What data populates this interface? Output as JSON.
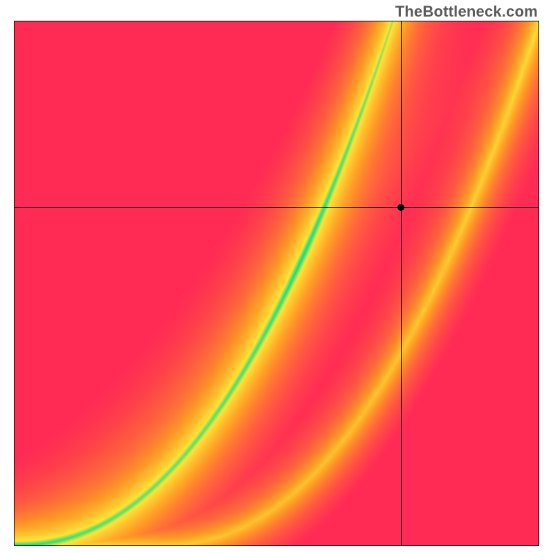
{
  "watermark": "TheBottleneck.com",
  "plot": {
    "crosshair": {
      "x_frac": 0.738,
      "y_frac": 0.355
    },
    "marker": {
      "x_frac": 0.738,
      "y_frac": 0.355
    },
    "ridge": {
      "x0": 0.0,
      "a": 2.05,
      "b": 2.2,
      "width0": 0.03,
      "width1": 0.11,
      "lobe_scale": 0.72
    },
    "colors": {
      "green": "#00e08a",
      "yellow": "#ffe536",
      "orange": "#ff9b26",
      "red": "#ff2b55"
    }
  },
  "chart_data": {
    "type": "heatmap",
    "title": "",
    "xlabel": "",
    "ylabel": "",
    "xlim": [
      0,
      1
    ],
    "ylim": [
      0,
      1
    ],
    "ridge_samples": [
      {
        "x": 0.0,
        "y": 0.0
      },
      {
        "x": 0.1,
        "y": 0.045
      },
      {
        "x": 0.2,
        "y": 0.125
      },
      {
        "x": 0.3,
        "y": 0.235
      },
      {
        "x": 0.4,
        "y": 0.37
      },
      {
        "x": 0.5,
        "y": 0.52
      },
      {
        "x": 0.6,
        "y": 0.68
      },
      {
        "x": 0.7,
        "y": 0.85
      },
      {
        "x": 0.76,
        "y": 0.96
      },
      {
        "x": 0.8,
        "y": 1.0
      }
    ],
    "secondary_lobe_offset": 0.28,
    "colorscale": [
      {
        "t": 0.0,
        "label": "green"
      },
      {
        "t": 0.18,
        "label": "yellow"
      },
      {
        "t": 0.55,
        "label": "orange"
      },
      {
        "t": 1.0,
        "label": "red"
      }
    ],
    "marker_point": {
      "x": 0.738,
      "y": 0.645
    },
    "annotations": []
  }
}
